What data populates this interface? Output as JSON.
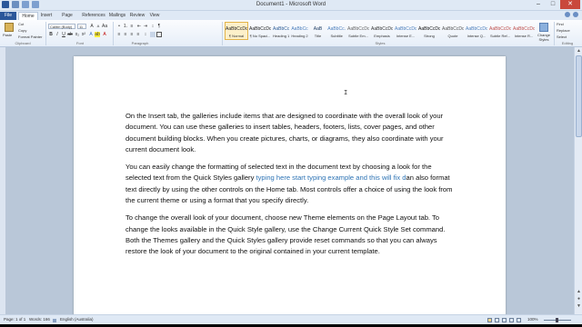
{
  "window": {
    "title": "Document1 - Microsoft Word",
    "controls": {
      "minimize": "–",
      "maximize": "□",
      "close": "✕"
    }
  },
  "tabs": [
    {
      "label": "File"
    },
    {
      "label": "Home"
    },
    {
      "label": "Insert"
    },
    {
      "label": "Page Layout"
    },
    {
      "label": "References"
    },
    {
      "label": "Mailings"
    },
    {
      "label": "Review"
    },
    {
      "label": "View"
    }
  ],
  "ribbon": {
    "clipboard": {
      "paste": "Paste",
      "cut": "Cut",
      "copy": "Copy",
      "format_painter": "Format Painter",
      "label": "Clipboard"
    },
    "font": {
      "name": "Calibri (Body)",
      "size": "11",
      "label": "Font"
    },
    "paragraph": {
      "label": "Paragraph"
    },
    "styles": {
      "label": "Styles",
      "items": [
        {
          "sample": "AaBbCcDc",
          "name": "¶ Normal",
          "color": "#222222"
        },
        {
          "sample": "AaBbCcDc",
          "name": "¶ No Spaci...",
          "color": "#222222"
        },
        {
          "sample": "AaBbCc",
          "name": "Heading 1",
          "color": "#2e5d96"
        },
        {
          "sample": "AaBbCc",
          "name": "Heading 2",
          "color": "#4f81bd"
        },
        {
          "sample": "AaB",
          "name": "Title",
          "color": "#17365d"
        },
        {
          "sample": "AaBbCc.",
          "name": "Subtitle",
          "color": "#4f81bd"
        },
        {
          "sample": "AaBbCcDc",
          "name": "Subtle Em...",
          "color": "#666666"
        },
        {
          "sample": "AaBbCcDc",
          "name": "Emphasis",
          "color": "#333333"
        },
        {
          "sample": "AaBbCcDc",
          "name": "Intense E...",
          "color": "#4f81bd"
        },
        {
          "sample": "AaBbCcDc",
          "name": "Strong",
          "color": "#111111"
        },
        {
          "sample": "AaBbCcDc",
          "name": "Quote",
          "color": "#555555"
        },
        {
          "sample": "AaBbCcDc",
          "name": "Intense Q...",
          "color": "#4f81bd"
        },
        {
          "sample": "AaBbCcDc",
          "name": "Subtle Ref...",
          "color": "#c0504d"
        },
        {
          "sample": "AaBbCcDc",
          "name": "Intense R...",
          "color": "#c0504d"
        }
      ]
    },
    "change_styles": "Change Styles",
    "editing": {
      "find": "Find",
      "replace": "Replace",
      "select": "Select",
      "label": "Editing"
    }
  },
  "document": {
    "cursor_glyph": "I",
    "paragraphs": [
      [
        {
          "text": "On the Insert tab, the galleries include items that are designed to coordinate with the overall look of your document. You can use these galleries to insert tables, headers, footers, lists, cover pages, and other document building blocks. When you create pictures, charts, or diagrams, they also coordinate with your current document look."
        }
      ],
      [
        {
          "text": "You can easily change the formatting of selected text in the document text by choosing a look for the selected text from the Quick Styles gallery "
        },
        {
          "text": "typing here start typing example and this will fix d",
          "highlight": true
        },
        {
          "text": "an also format text directly by using the other controls on the Home tab. Most controls offer a choice of using the look from the current theme or using a format that you specify directly."
        }
      ],
      [
        {
          "text": "To change the overall look of your document, choose new Theme elements on the Page Layout tab. To change the looks available in the Quick Style gallery, use the Change Current Quick Style Set command. Both the Themes gallery and the Quick Styles gallery provide reset commands so that you can always restore the look of your document to the original contained in your current template."
        }
      ]
    ]
  },
  "status": {
    "page": "Page: 1 of 1",
    "words": "Words: 166",
    "language": "English (Australia)",
    "zoom": "100%"
  },
  "colors": {
    "accent": "#2b579a",
    "highlight_text": "#2e74b5",
    "ribbon_bg": "#e6eef8",
    "doc_bg": "#b9c7d8"
  }
}
